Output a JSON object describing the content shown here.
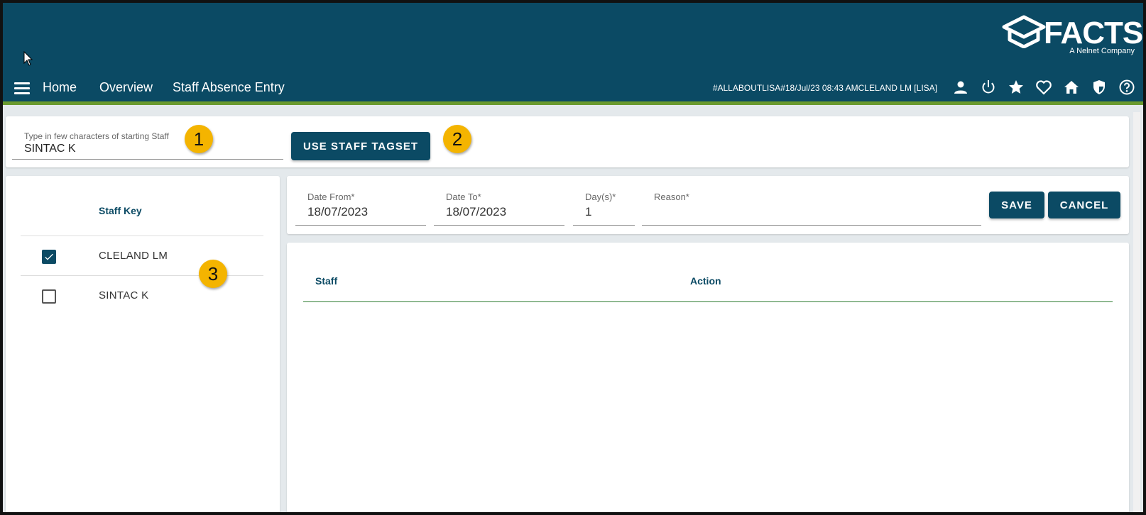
{
  "header": {
    "logo_text": "FACTS",
    "logo_subtitle": "A Nelnet Company",
    "nav": [
      "Home",
      "Overview",
      "Staff Absence Entry"
    ],
    "session_info": "#ALLABOUTLISA#18/Jul/23 08:43 AMCLELAND LM [LISA]",
    "icons": [
      "user-icon",
      "power-icon",
      "star-icon",
      "heart-icon",
      "home-icon",
      "shield-icon",
      "help-icon"
    ]
  },
  "search": {
    "label": "Type in few characters of starting Staff",
    "value": "SINTAC K",
    "tagset_button": "USE STAFF TAGSET"
  },
  "callouts": [
    "1",
    "2",
    "3"
  ],
  "staff_list": {
    "header": "Staff Key",
    "items": [
      {
        "name": "CLELAND LM",
        "checked": true
      },
      {
        "name": "SINTAC K",
        "checked": false
      }
    ]
  },
  "form": {
    "date_from_label": "Date From*",
    "date_from_value": "18/07/2023",
    "date_to_label": "Date To*",
    "date_to_value": "18/07/2023",
    "days_label": "Day(s)*",
    "days_value": "1",
    "reason_label": "Reason*",
    "reason_value": "",
    "save_button": "SAVE",
    "cancel_button": "CANCEL"
  },
  "table": {
    "columns": [
      "Staff",
      "Action"
    ]
  },
  "colors": {
    "primary": "#0b4a64",
    "accent_line": "#6a9a2e",
    "callout": "#f4b400"
  }
}
